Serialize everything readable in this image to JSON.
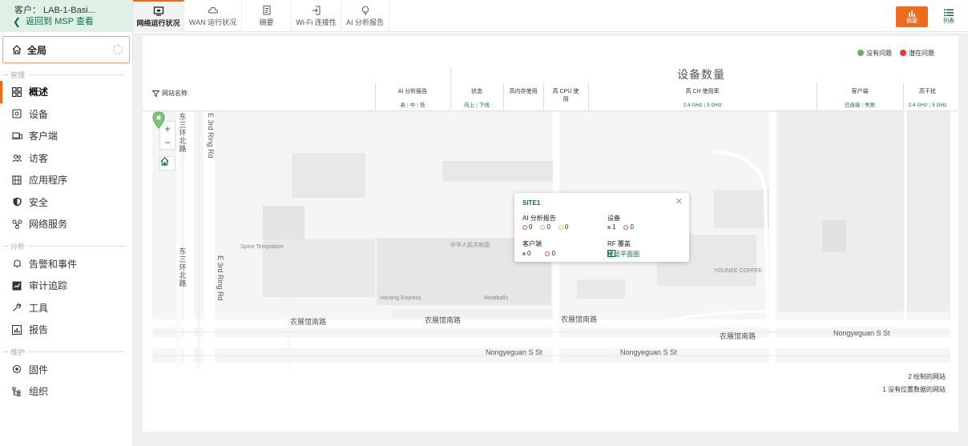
{
  "sidebar": {
    "customer_label": "客户：  LAB-1-Basi...",
    "back_label": "返回到 MSP 查看",
    "scope_label": "全局",
    "sections": {
      "manage": "管理",
      "analyze": "分析",
      "maintain": "维护"
    },
    "items": [
      {
        "label": "概述",
        "icon": "grid-icon"
      },
      {
        "label": "设备",
        "icon": "device-icon"
      },
      {
        "label": "客户端",
        "icon": "client-icon"
      },
      {
        "label": "访客",
        "icon": "guests-icon"
      },
      {
        "label": "应用程序",
        "icon": "apps-icon"
      },
      {
        "label": "安全",
        "icon": "shield-icon"
      },
      {
        "label": "网络服务",
        "icon": "network-services-icon"
      },
      {
        "label": "告警和事件",
        "icon": "bell-icon"
      },
      {
        "label": "审计追踪",
        "icon": "audit-icon"
      },
      {
        "label": "工具",
        "icon": "wrench-icon"
      },
      {
        "label": "报告",
        "icon": "report-icon"
      },
      {
        "label": "固件",
        "icon": "firmware-icon"
      },
      {
        "label": "组织",
        "icon": "org-icon"
      }
    ]
  },
  "tabs": [
    {
      "label": "网络运行状况"
    },
    {
      "label": "WAN 运行状况"
    },
    {
      "label": "摘要"
    },
    {
      "label": "Wi-Fi 连接性"
    },
    {
      "label": "AI 分析报告"
    }
  ],
  "toolbar": {
    "summary_label": "摘要",
    "list_label": "列表"
  },
  "legend": {
    "no_issue": "没有问题",
    "potential_issue": "潜在问题",
    "green": "#5cb85c",
    "red": "#e53a2a"
  },
  "table": {
    "group_title": "设备数量",
    "site_name": "网站名称",
    "ai_reports": "AI 分析报告",
    "ai_sub": [
      "高",
      "中",
      "低"
    ],
    "status": "状态",
    "status_sub": [
      "向上",
      "下线"
    ],
    "high_mem": "高内存使用",
    "high_cpu": "高 CPU 使用",
    "high_ch": "高 CH 使用率",
    "ch_sub": [
      "2.4 GHz",
      "5 GHz"
    ],
    "clients": "客户端",
    "clients_sub": [
      "已连接",
      "失败"
    ],
    "high_interf": "高干扰",
    "interf_sub": [
      "2.4 GHz",
      "5 GHz"
    ]
  },
  "map": {
    "labels": {
      "east_ring_cn": "东三环北路",
      "east_ring_en": "E 3rd Ring Rd",
      "spice": "Spice Temptation",
      "prc": "中华人民共和国",
      "hanting": "Hanting Express",
      "meatballs": "Meatballs",
      "younee": "YOUNEE COFFEE",
      "road_cn": "农展馆南路",
      "road_en": "Nongyeguan S St"
    },
    "popup": {
      "title": "SITE1",
      "ai_label": "AI 分析报告",
      "ai_values": [
        "0",
        "0",
        "0"
      ],
      "device_label": "设备",
      "device_values": [
        "1",
        "0"
      ],
      "client_label": "客户端",
      "client_values": [
        "0",
        "0"
      ],
      "rf_label": "RF 覆盖",
      "rf_link": "楼层平面图"
    }
  },
  "footer": {
    "drawn": "2 绘制的网站",
    "no_location": "1 没有位置数据的网站"
  }
}
